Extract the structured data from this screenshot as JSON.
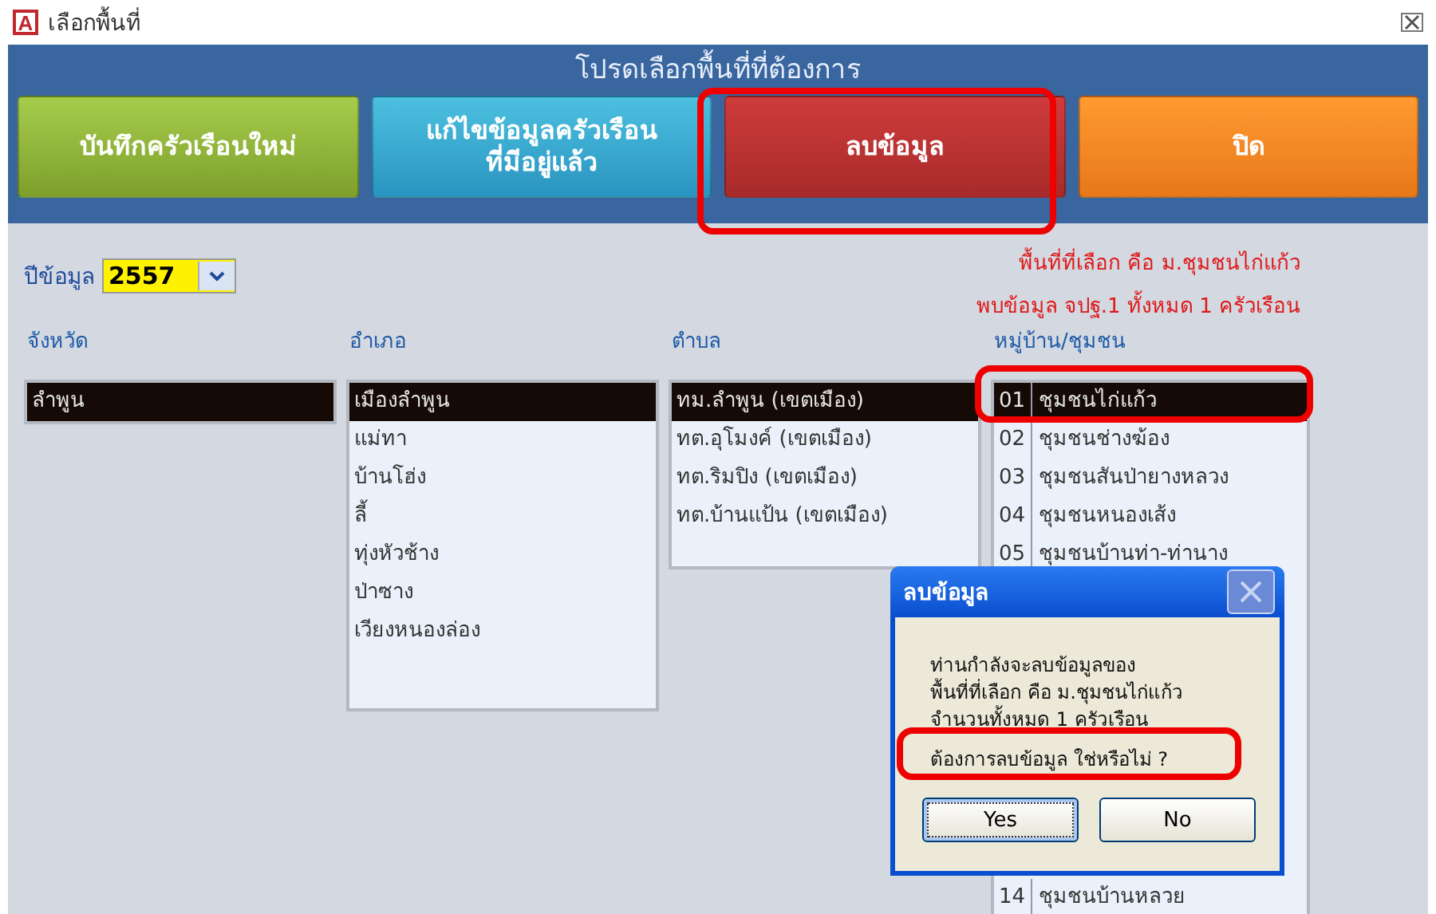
{
  "window": {
    "icon_letter": "A",
    "title": "เลือกพื้นที่"
  },
  "header": {
    "prompt": "โปรดเลือกพื้นที่ที่ต้องการ"
  },
  "actions": [
    {
      "label": "บันทึกครัวเรือนใหม่",
      "kind": "add"
    },
    {
      "label": "แก้ไขข้อมูลครัวเรือน\nที่มีอยู่แล้ว",
      "kind": "edit"
    },
    {
      "label": "ลบข้อมูล",
      "kind": "delete"
    },
    {
      "label": "ปิด",
      "kind": "close"
    }
  ],
  "year": {
    "label": "ปีข้อมูล",
    "value": "2557"
  },
  "summary": [
    "พื้นที่ที่เลือก คือ ม.ชุมชนไก่แก้ว",
    "พบข้อมูล จปฐ.1 ทั้งหมด  1  ครัวเรือน"
  ],
  "lists": [
    {
      "heading": "จังหวัด",
      "items": [
        {
          "label": "ลำพูน",
          "selected": true
        }
      ]
    },
    {
      "heading": "อำเภอ",
      "items": [
        {
          "label": "เมืองลำพูน",
          "selected": true
        },
        {
          "label": "แม่ทา",
          "selected": false
        },
        {
          "label": "บ้านโฮ่ง",
          "selected": false
        },
        {
          "label": "ลี้",
          "selected": false
        },
        {
          "label": "ทุ่งหัวช้าง",
          "selected": false
        },
        {
          "label": "ป่าซาง",
          "selected": false
        },
        {
          "label": "เวียงหนองล่อง",
          "selected": false
        }
      ]
    },
    {
      "heading": "ตำบล",
      "items": [
        {
          "label": "ทม.ลำพูน (เขตเมือง)",
          "selected": true
        },
        {
          "label": "ทต.อุโมงค์ (เขตเมือง)",
          "selected": false
        },
        {
          "label": "ทต.ริมปิง (เขตเมือง)",
          "selected": false
        },
        {
          "label": "ทต.บ้านแป้น (เขตเมือง)",
          "selected": false
        }
      ]
    },
    {
      "heading": "หมู่บ้าน/ชุมชน",
      "items": [
        {
          "code": "01",
          "label": "ชุมชนไก่แก้ว",
          "selected": true
        },
        {
          "code": "02",
          "label": "ชุมชนช่างฆ้อง",
          "selected": false
        },
        {
          "code": "03",
          "label": "ชุมชนสันป่ายางหลวง",
          "selected": false
        },
        {
          "code": "04",
          "label": "ชุมชนหนองเส้ง",
          "selected": false
        },
        {
          "code": "05",
          "label": "ชุมชนบ้านท่า-ท่านาง",
          "selected": false
        }
      ],
      "items_after_dialog": [
        {
          "code": "14",
          "label": "ชุมชนบ้านหลวย",
          "selected": false
        }
      ]
    }
  ],
  "dialog": {
    "title": "ลบข้อมูล",
    "message": [
      "ท่านกำลังจะลบข้อมูลของ",
      "พื้นที่ที่เลือก คือ ม.ชุมชนไก่แก้ว",
      "จำนวนทั้งหมด  1  ครัวเรือน",
      "ต้องการลบข้อมูล ใช่หรือไม่ ?"
    ],
    "buttons": [
      {
        "label": "Yes",
        "default": true
      },
      {
        "label": "No",
        "default": false
      }
    ]
  }
}
